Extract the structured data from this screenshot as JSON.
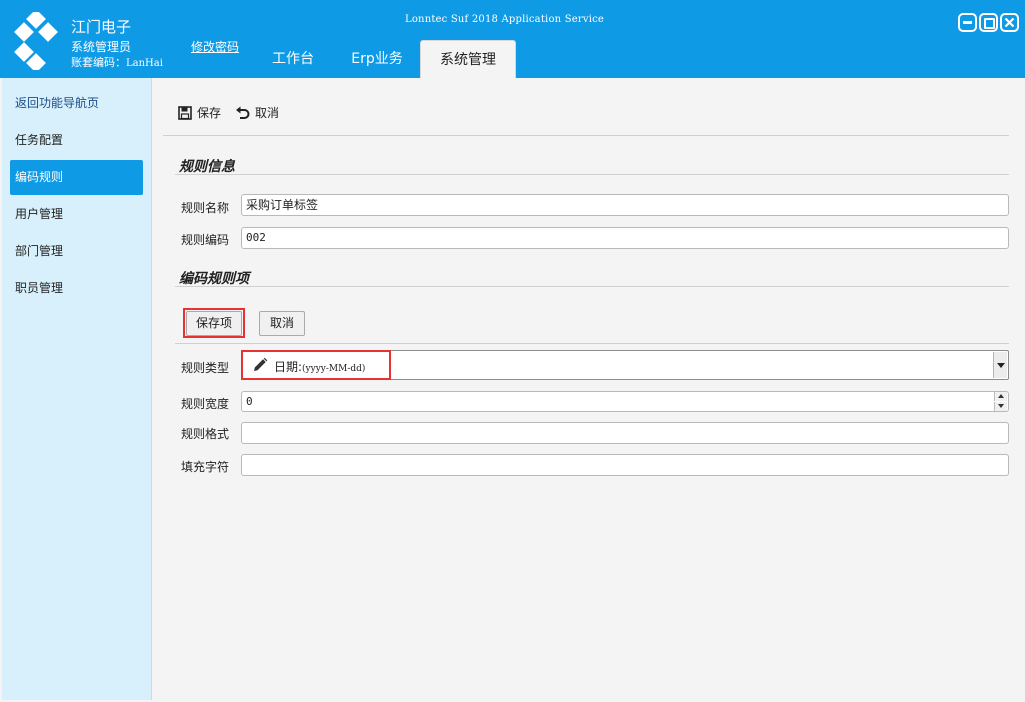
{
  "header": {
    "company": "江门电子",
    "user_role": "系统管理员",
    "account_label": "账套编码：",
    "account_code": "LanHai",
    "change_password": "修改密码",
    "app_title": "Lonntec Suf 2018 Application Service",
    "background_color": "#0f9ae6"
  },
  "window_controls": [
    "minimize-icon",
    "maximize-icon",
    "close-icon"
  ],
  "nav_tabs": [
    {
      "label": "工作台"
    },
    {
      "label": "Erp业务"
    },
    {
      "label": "系统管理",
      "active": true
    }
  ],
  "sidebar": {
    "items": [
      {
        "label": "返回功能导航页"
      },
      {
        "label": "任务配置"
      },
      {
        "label": "编码规则",
        "active": true
      },
      {
        "label": "用户管理"
      },
      {
        "label": "部门管理"
      },
      {
        "label": "职员管理"
      }
    ],
    "background_color": "#d8f0fb",
    "active_color": "#0f9ae6"
  },
  "toolbar": {
    "save": "保存",
    "cancel": "取消"
  },
  "rule_info": {
    "title": "规则信息",
    "name_label": "规则名称",
    "name_value": "采购订单标签",
    "code_label": "规则编码",
    "code_value": "002"
  },
  "rule_items": {
    "title": "编码规则项",
    "save_item": "保存项",
    "cancel": "取消",
    "type_label": "规则类型",
    "type_value_prefix": "日期:",
    "type_value_format": "(yyyy-MM-dd)",
    "width_label": "规则宽度",
    "width_value": "0",
    "format_label": "规则格式",
    "format_value": "",
    "fill_label": "填充字符",
    "fill_value": ""
  },
  "highlight_color": "#e53333"
}
